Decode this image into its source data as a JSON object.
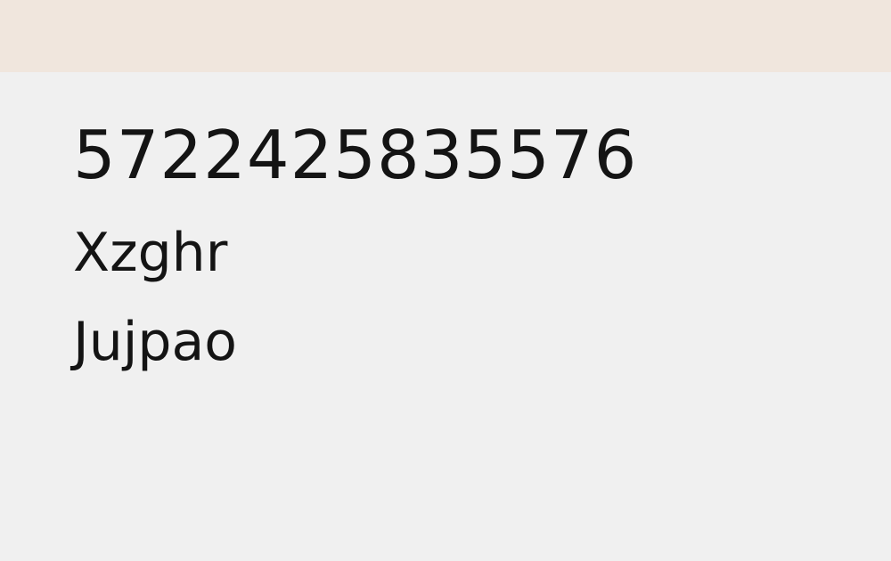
{
  "header": {
    "background_color": "#f0e6dd"
  },
  "content": {
    "number": "5722425835576",
    "line1": "Xzghr",
    "line2": "Jujpao"
  }
}
